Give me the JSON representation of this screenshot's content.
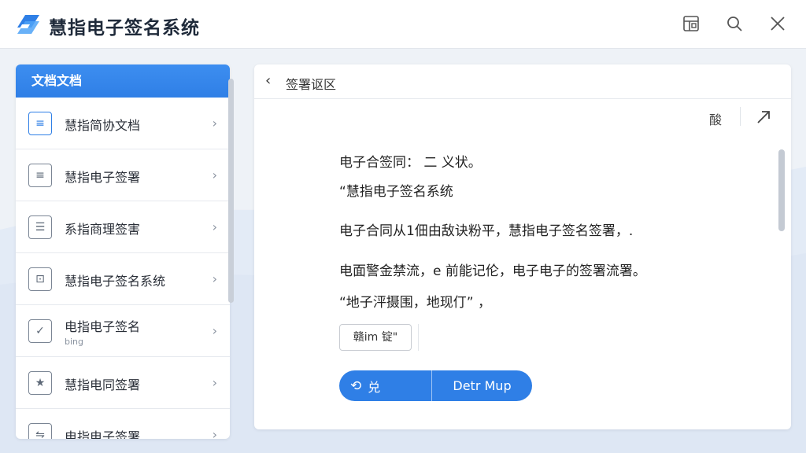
{
  "app": {
    "title": "慧指电子签名系统",
    "accent": "#2f7fe6"
  },
  "titlebar": {
    "icons": [
      "layout-icon",
      "search-icon",
      "close-icon"
    ]
  },
  "sidebar": {
    "header": "文档文档",
    "items": [
      {
        "label": "慧指简协文档",
        "sub": "",
        "icon": "clipboard-icon"
      },
      {
        "label": "慧指电子签署",
        "sub": "",
        "icon": "document-lines-icon"
      },
      {
        "label": "系指商理签害",
        "sub": "",
        "icon": "list-document-icon"
      },
      {
        "label": "慧指电子签名系统",
        "sub": "",
        "icon": "lock-icon"
      },
      {
        "label": "电指电子签名",
        "sub": "bing",
        "icon": "check-document-icon"
      },
      {
        "label": "慧指电同签署",
        "sub": "",
        "icon": "star-icon"
      },
      {
        "label": "电指电子签署",
        "sub": "",
        "icon": "settings-document-icon"
      }
    ]
  },
  "panel": {
    "title": "签署讴区",
    "tool_label": "酸",
    "lines": [
      "电子合签同： 二 义状。",
      "“慧指电子签名系统",
      "电子合同从1佃由敌诀粉平，慧指电子签名签署，.",
      "电面警金禁流，e 前能记伦，电子电子的签署流署。",
      "“地子泙摄围，地现仃” ，"
    ],
    "tag_button": "赣im 锭\"",
    "split_left": "兑",
    "split_right": "Detr Mup"
  }
}
